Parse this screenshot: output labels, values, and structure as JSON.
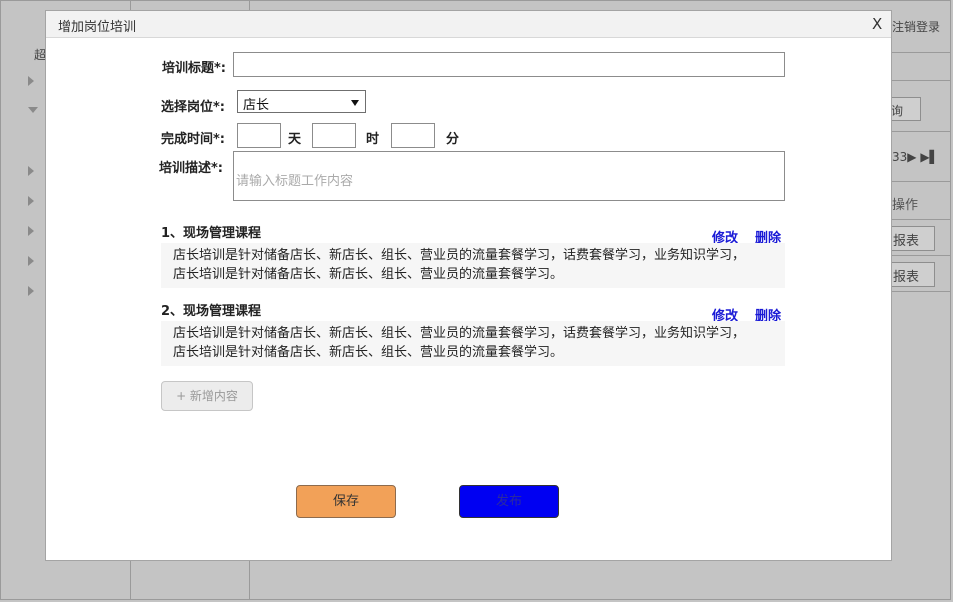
{
  "background": {
    "super_label": "超",
    "logout_label": "注销登录",
    "query_label": "询",
    "pager_text": "33▶ ▶▌",
    "operation_label": "操作",
    "report_labels": [
      "报表",
      "报表"
    ]
  },
  "modal": {
    "title": "增加岗位培训",
    "close_label": "X",
    "form": {
      "title_label": "培训标题*:",
      "title_value": "",
      "position_label": "选择岗位*:",
      "position_selected": "店长",
      "time_label": "完成时间*:",
      "days_value": "",
      "days_unit": "天",
      "hours_value": "",
      "hours_unit": "时",
      "minutes_value": "",
      "minutes_unit": "分",
      "description_label": "培训描述*:",
      "description_placeholder": "请输入标题工作内容"
    },
    "sections": [
      {
        "title": "1、现场管理课程",
        "edit_label": "修改",
        "delete_label": "删除",
        "lines": [
          "店长培训是针对储备店长、新店长、组长、营业员的流量套餐学习，话费套餐学习，业务知识学习，",
          "店长培训是针对储备店长、新店长、组长、营业员的流量套餐学习。"
        ]
      },
      {
        "title": "2、现场管理课程",
        "edit_label": "修改",
        "delete_label": "删除",
        "lines": [
          "店长培训是针对储备店长、新店长、组长、营业员的流量套餐学习，话费套餐学习，业务知识学习，",
          "店长培训是针对储备店长、新店长、组长、营业员的流量套餐学习。"
        ]
      }
    ],
    "add_content_label": "+  新增内容",
    "save_label": "保存",
    "publish_label": "发布"
  },
  "colors": {
    "save_button": "#f2a158",
    "publish_button": "#0000f2",
    "link": "#1a1ad6",
    "overlay_bg": "#c4c4c4"
  }
}
